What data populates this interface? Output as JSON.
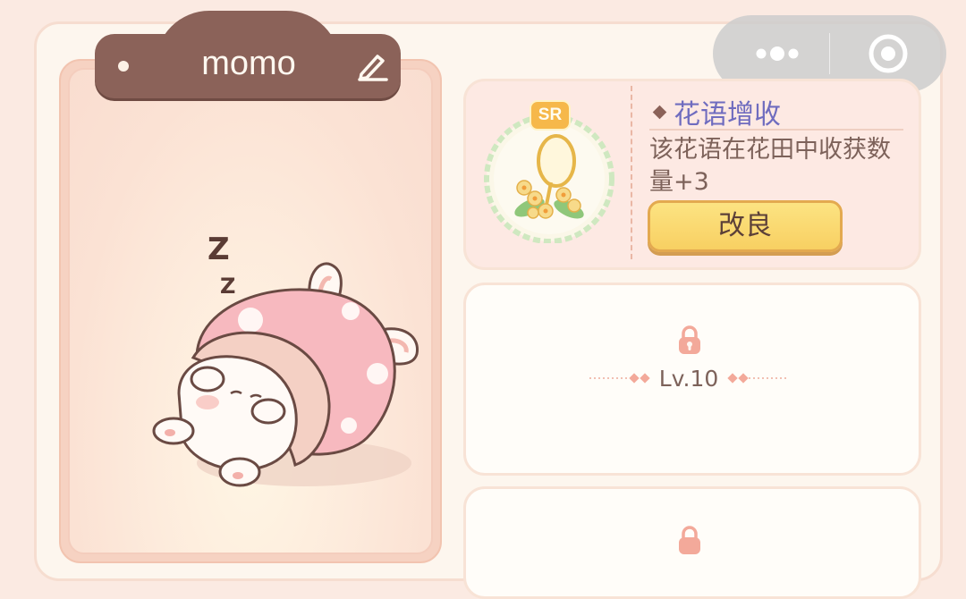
{
  "profile": {
    "name": "momo"
  },
  "active_skill": {
    "rarity": "SR",
    "title": "花语增收",
    "description": "该花语在花田中收获数量+3",
    "upgrade_label": "改良"
  },
  "locked_skills": [
    {
      "level_label": "Lv.10"
    }
  ],
  "icons": {
    "edit": "pencil-icon",
    "more": "more-dots-icon",
    "close": "target-close-icon",
    "lock": "lock-icon"
  },
  "colors": {
    "name_plate": "#8b6259",
    "skill_title": "#6f6cbf",
    "button_yellow": "#f8d062",
    "lock_pink": "#f3a99a"
  }
}
